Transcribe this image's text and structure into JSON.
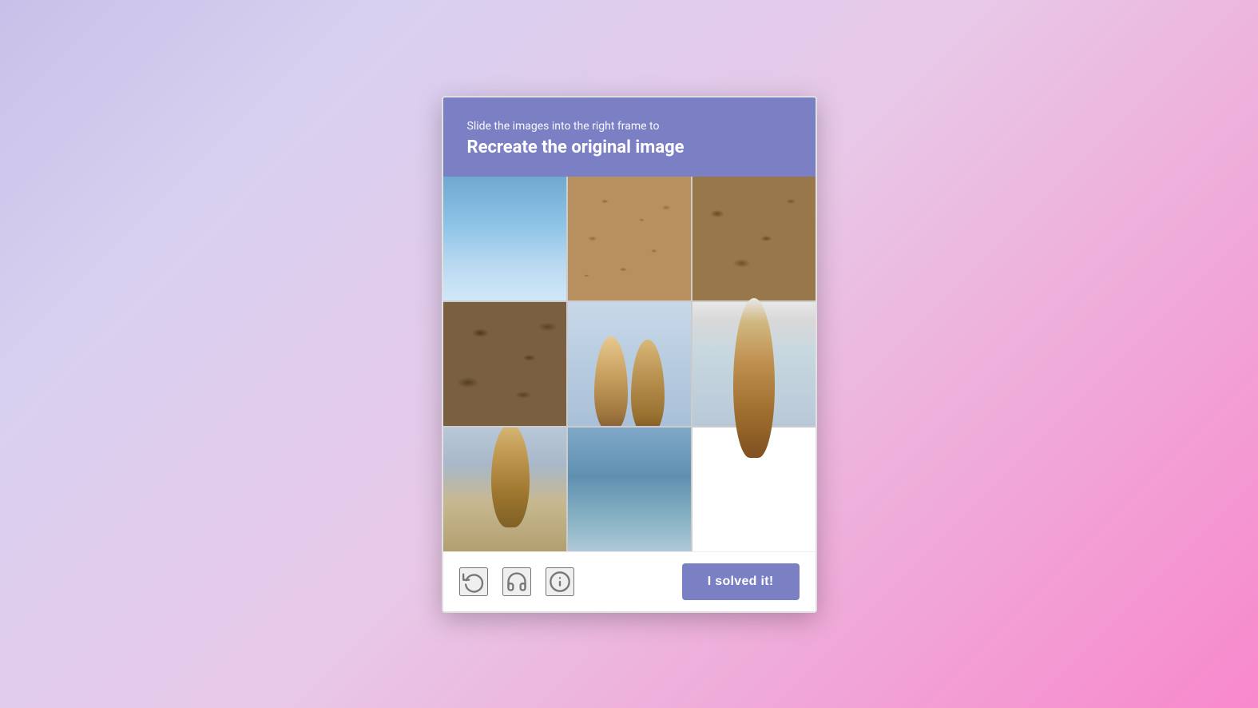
{
  "header": {
    "subtitle": "Slide the images into the right frame to",
    "title": "Recreate the original image"
  },
  "footer": {
    "icons": [
      {
        "name": "refresh-icon",
        "label": "Refresh"
      },
      {
        "name": "headphones-icon",
        "label": "Audio"
      },
      {
        "name": "info-icon",
        "label": "Info"
      }
    ],
    "solved_button_label": "I solved it!"
  },
  "puzzle": {
    "grid_size": "3x3",
    "description": "Surfboard beach puzzle"
  }
}
